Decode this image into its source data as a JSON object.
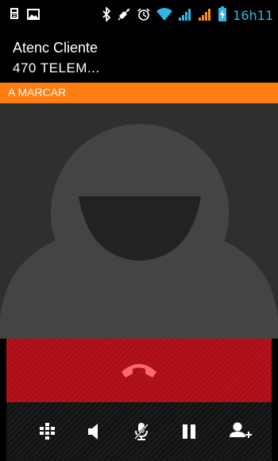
{
  "status_bar": {
    "time": "16h11",
    "time_color": "#33b5e5",
    "left_icons": [
      "sim-toolkit-icon",
      "picture-icon"
    ],
    "right_icons": [
      "bluetooth-icon",
      "mute-icon",
      "alarm-icon",
      "wifi-icon",
      "signal-icon",
      "signal-icon",
      "battery-charging-icon"
    ]
  },
  "caller": {
    "name": "Atenc Cliente",
    "number": "470 TELEM..."
  },
  "call_state": {
    "label": "A MARCAR",
    "color": "#ff7d12"
  },
  "end_call": {
    "icon": "end-call-icon",
    "color": "#b5121b"
  },
  "controls": [
    {
      "icon": "dialpad-icon"
    },
    {
      "icon": "speaker-icon"
    },
    {
      "icon": "mute-mic-icon"
    },
    {
      "icon": "pause-icon"
    },
    {
      "icon": "add-call-icon"
    }
  ]
}
